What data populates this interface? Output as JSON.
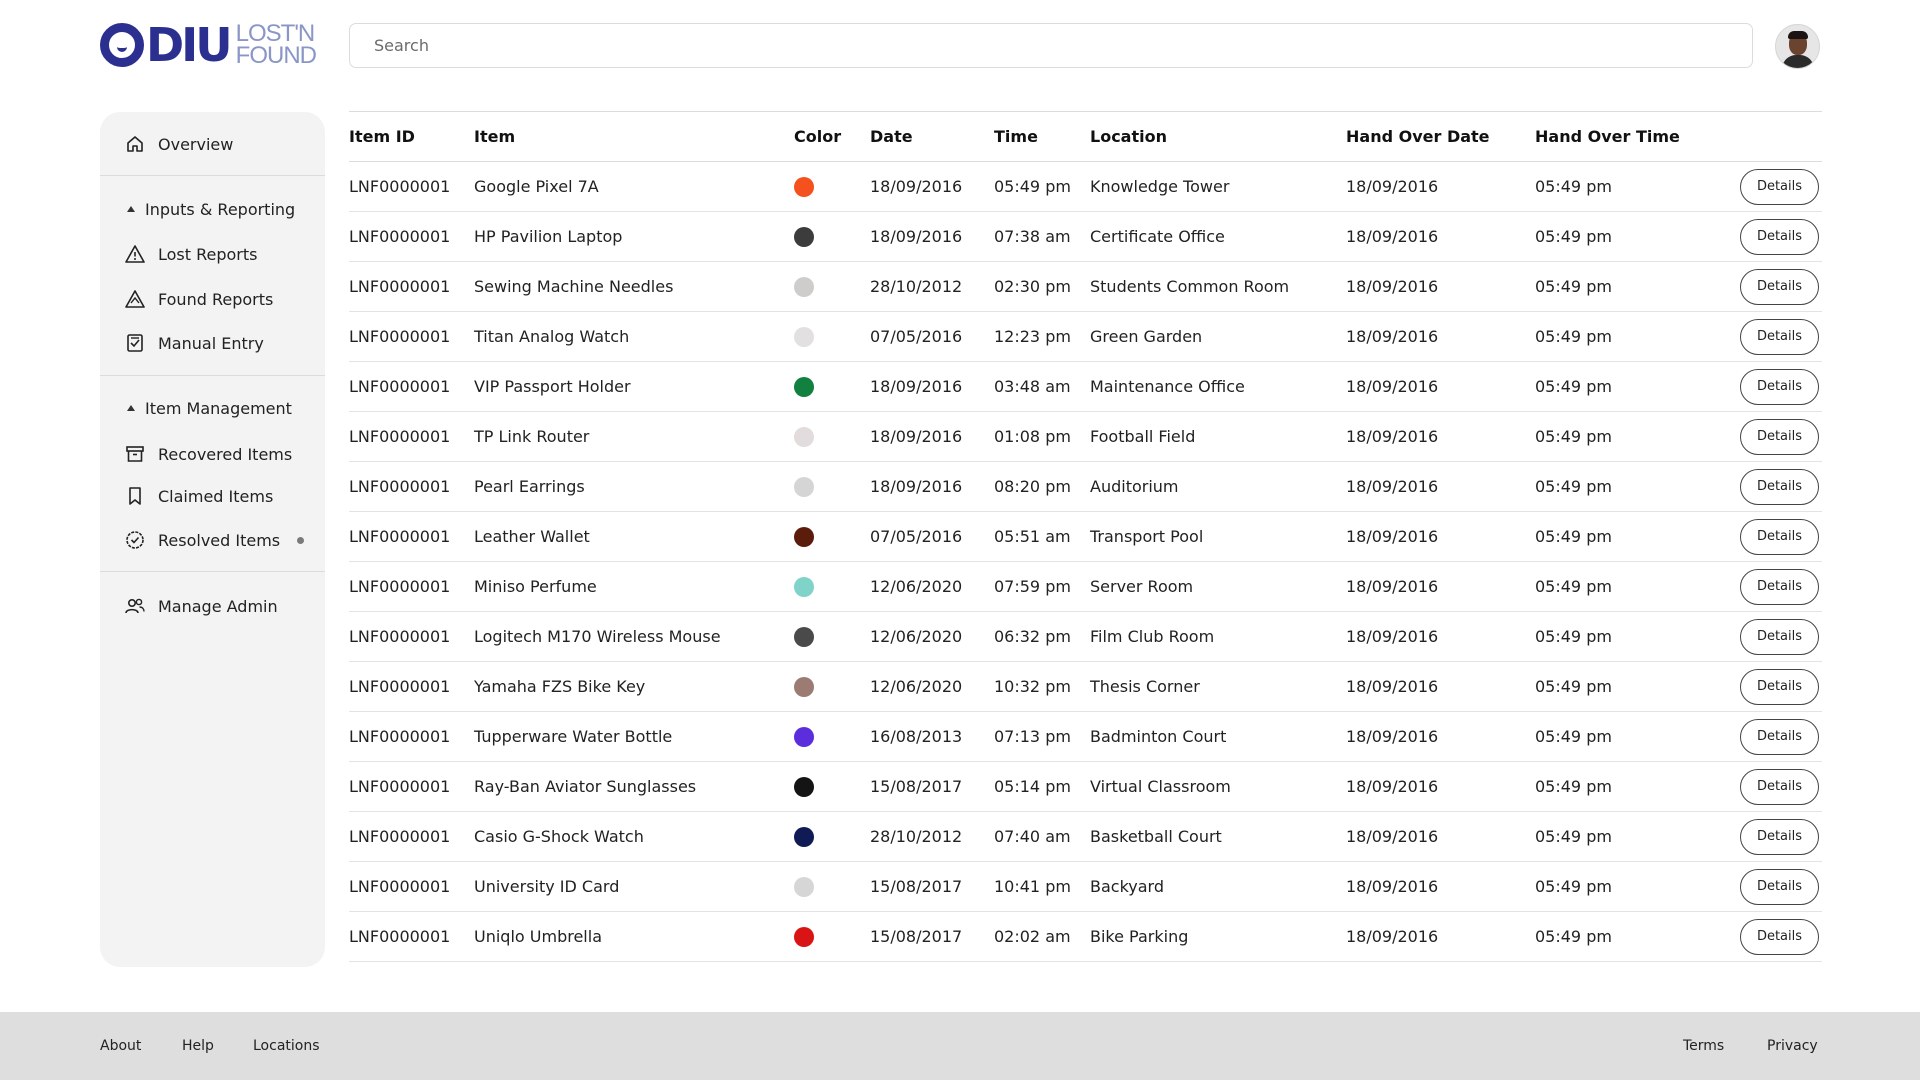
{
  "brand": {
    "name": "DIU",
    "line1": "LOST'N",
    "line2": "FOUND",
    "primary_color": "#2b2f8f",
    "secondary_color": "#8a96c8"
  },
  "search": {
    "placeholder": "Search",
    "value": ""
  },
  "user": {
    "avatar_icon": "user-avatar"
  },
  "sidebar": {
    "overview": "Overview",
    "group_inputs": "Inputs & Reporting",
    "lost_reports": "Lost Reports",
    "found_reports": "Found Reports",
    "manual_entry": "Manual Entry",
    "group_items": "Item Management",
    "recovered_items": "Recovered Items",
    "claimed_items": "Claimed Items",
    "resolved_items": "Resolved Items",
    "manage_admin": "Manage Admin"
  },
  "table": {
    "headers": [
      "Item ID",
      "Item",
      "Color",
      "Date",
      "Time",
      "Location",
      "Hand Over Date",
      "Hand Over Time"
    ],
    "details_label": "Details",
    "rows": [
      {
        "id": "LNF0000001",
        "item": "Google Pixel 7A",
        "color": "#f4511e",
        "date": "18/09/2016",
        "time": "05:49 pm",
        "location": "Knowledge Tower",
        "hdate": "18/09/2016",
        "htime": "05:49 pm"
      },
      {
        "id": "LNF0000001",
        "item": "HP Pavilion Laptop",
        "color": "#3c3c3c",
        "date": "18/09/2016",
        "time": "07:38 am",
        "location": "Certificate Office",
        "hdate": "18/09/2016",
        "htime": "05:49 pm"
      },
      {
        "id": "LNF0000001",
        "item": "Sewing Machine Needles",
        "color": "#cfcccc",
        "date": "28/10/2012",
        "time": "02:30 pm",
        "location": "Students Common Room",
        "hdate": "18/09/2016",
        "htime": "05:49 pm"
      },
      {
        "id": "LNF0000001",
        "item": "Titan Analog Watch",
        "color": "#e2e0e0",
        "date": "07/05/2016",
        "time": "12:23 pm",
        "location": "Green Garden",
        "hdate": "18/09/2016",
        "htime": "05:49 pm"
      },
      {
        "id": "LNF0000001",
        "item": "VIP Passport Holder",
        "color": "#12803f",
        "date": "18/09/2016",
        "time": "03:48 am",
        "location": "Maintenance Office",
        "hdate": "18/09/2016",
        "htime": "05:49 pm"
      },
      {
        "id": "LNF0000001",
        "item": "TP Link Router",
        "color": "#e3dcdc",
        "date": "18/09/2016",
        "time": "01:08 pm",
        "location": "Football Field",
        "hdate": "18/09/2016",
        "htime": "05:49 pm"
      },
      {
        "id": "LNF0000001",
        "item": "Pearl Earrings",
        "color": "#d5d5d5",
        "date": "18/09/2016",
        "time": "08:20 pm",
        "location": "Auditorium",
        "hdate": "18/09/2016",
        "htime": "05:49 pm"
      },
      {
        "id": "LNF0000001",
        "item": "Leather Wallet",
        "color": "#5b1c0c",
        "date": "07/05/2016",
        "time": "05:51 am",
        "location": "Transport Pool",
        "hdate": "18/09/2016",
        "htime": "05:49 pm"
      },
      {
        "id": "LNF0000001",
        "item": "Miniso Perfume",
        "color": "#7fd3c8",
        "date": "12/06/2020",
        "time": "07:59 pm",
        "location": "Server Room",
        "hdate": "18/09/2016",
        "htime": "05:49 pm"
      },
      {
        "id": "LNF0000001",
        "item": "Logitech M170 Wireless Mouse",
        "color": "#4a4a4a",
        "date": "12/06/2020",
        "time": "06:32 pm",
        "location": "Film Club Room",
        "hdate": "18/09/2016",
        "htime": "05:49 pm"
      },
      {
        "id": "LNF0000001",
        "item": "Yamaha FZS Bike Key",
        "color": "#9c7b72",
        "date": "12/06/2020",
        "time": "10:32 pm",
        "location": "Thesis Corner",
        "hdate": "18/09/2016",
        "htime": "05:49 pm"
      },
      {
        "id": "LNF0000001",
        "item": "Tupperware Water Bottle",
        "color": "#5b2ddc",
        "date": "16/08/2013",
        "time": "07:13 pm",
        "location": "Badminton Court",
        "hdate": "18/09/2016",
        "htime": "05:49 pm"
      },
      {
        "id": "LNF0000001",
        "item": "Ray-Ban Aviator Sunglasses",
        "color": "#141414",
        "date": "15/08/2017",
        "time": "05:14 pm",
        "location": "Virtual Classroom",
        "hdate": "18/09/2016",
        "htime": "05:49 pm"
      },
      {
        "id": "LNF0000001",
        "item": "Casio G-Shock Watch",
        "color": "#101a55",
        "date": "28/10/2012",
        "time": "07:40 am",
        "location": "Basketball Court",
        "hdate": "18/09/2016",
        "htime": "05:49 pm"
      },
      {
        "id": "LNF0000001",
        "item": "University ID Card",
        "color": "#d6d6d6",
        "date": "15/08/2017",
        "time": "10:41 pm",
        "location": "Backyard",
        "hdate": "18/09/2016",
        "htime": "05:49 pm"
      },
      {
        "id": "LNF0000001",
        "item": "Uniqlo Umbrella",
        "color": "#d91414",
        "date": "15/08/2017",
        "time": "02:02 am",
        "location": "Bike Parking",
        "hdate": "18/09/2016",
        "htime": "05:49 pm"
      }
    ]
  },
  "footer": {
    "about": "About",
    "help": "Help",
    "locations": "Locations",
    "terms": "Terms",
    "privacy": "Privacy"
  }
}
